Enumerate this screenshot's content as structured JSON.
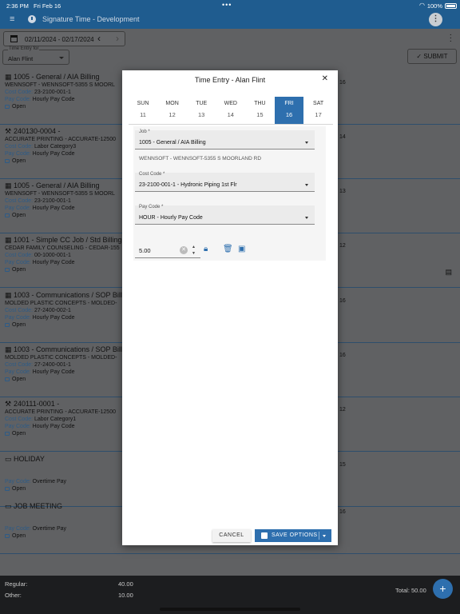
{
  "status_bar": {
    "time": "2:36 PM",
    "date": "Fri Feb 16",
    "dots": "•••",
    "battery": "100%"
  },
  "app_bar": {
    "title": "Signature Time - Development"
  },
  "toolbar": {
    "date_range": "02/11/2024 - 02/17/2024",
    "time_entry_for_label": "Time Entry for",
    "time_entry_for_value": "Alan Flint",
    "submit_label": "SUBMIT"
  },
  "entries": [
    {
      "icon": "building-icon",
      "title": "1005 - General / AIA Billing",
      "sub": "WENNSOFT - WENNSOFT-5355 S MOORL",
      "cost_code": "23-2100-001-1",
      "pay_code": "Hourly Pay Code",
      "status": "Open",
      "hours": "16"
    },
    {
      "icon": "hammer-icon",
      "title": "240130-0004 -",
      "sub": "ACCURATE PRINTING - ACCURATE-12500",
      "cost_code": "Labor Category3",
      "pay_code": "Hourly Pay Code",
      "status": "Open",
      "hours": "14"
    },
    {
      "icon": "building-icon",
      "title": "1005 - General / AIA Billing",
      "sub": "WENNSOFT - WENNSOFT-5355 S MOORL",
      "cost_code": "23-2100-001-1",
      "pay_code": "Hourly Pay Code",
      "status": "Open",
      "hours": "13"
    },
    {
      "icon": "building-icon",
      "title": "1001 - Simple CC Job / Std Billing",
      "sub": "CEDAR FAMILY COUNSELING - CEDAR-155",
      "cost_code": "00-1000-001-1",
      "pay_code": "Hourly Pay Code",
      "status": "Open",
      "hours": "12"
    },
    {
      "icon": "building-icon",
      "title": "1003 - Communications / SOP Bill",
      "sub": "MOLDED PLASTIC CONCEPTS - MOLDED-",
      "cost_code": "27-2400-002-1",
      "pay_code": "Hourly Pay Code",
      "status": "Open",
      "hours": "16"
    },
    {
      "icon": "building-icon",
      "title": "1003 - Communications / SOP Bill",
      "sub": "MOLDED PLASTIC CONCEPTS - MOLDED-",
      "cost_code": "27-2400-001-1",
      "pay_code": "Hourly Pay Code",
      "status": "Open",
      "hours": "16"
    },
    {
      "icon": "hammer-icon",
      "title": "240111-0001 -",
      "sub": "ACCURATE PRINTING - ACCURATE-12500",
      "cost_code": "Labor Category1",
      "pay_code": "Hourly Pay Code",
      "status": "Open",
      "hours": "12"
    },
    {
      "icon": "cash-icon",
      "title": "HOLIDAY",
      "sub": "",
      "cost_code": "",
      "pay_code": "Overtime Pay",
      "status": "Open",
      "hours": "15"
    },
    {
      "icon": "cash-icon",
      "title": "JOB MEETING",
      "sub": "",
      "cost_code": "",
      "pay_code": "Overtime Pay",
      "status": "Open",
      "hours": "16"
    }
  ],
  "labels": {
    "cost_code": "Cost Code:",
    "pay_code": "Pay Code:"
  },
  "footer": {
    "regular_label": "Regular:",
    "regular_value": "40.00",
    "other_label": "Other:",
    "other_value": "10.00",
    "total": "Total: 50.00"
  },
  "dialog": {
    "title": "Time Entry - Alan Flint",
    "days": [
      {
        "name": "SUN",
        "num": "11"
      },
      {
        "name": "MON",
        "num": "12"
      },
      {
        "name": "TUE",
        "num": "13"
      },
      {
        "name": "WED",
        "num": "14"
      },
      {
        "name": "THU",
        "num": "15"
      },
      {
        "name": "FRI",
        "num": "16"
      },
      {
        "name": "SAT",
        "num": "17"
      }
    ],
    "job_label": "Job *",
    "job_value": "1005 - General / AIA Billing",
    "job_helper": "WENNSOFT - WENNSOFT-5355 S MOORLAND RD",
    "cost_code_label": "Cost Code *",
    "cost_code_value": "23-2100-001-1 - Hydronic Piping 1st Flr",
    "pay_code_label": "Pay Code *",
    "pay_code_value": "HOUR - Hourly Pay Code",
    "hours_value": "5.00",
    "cancel_label": "CANCEL",
    "save_label": "SAVE OPTIONS"
  },
  "colors": {
    "primary": "#2e6fae",
    "app_bar": "#1f5c8f"
  }
}
